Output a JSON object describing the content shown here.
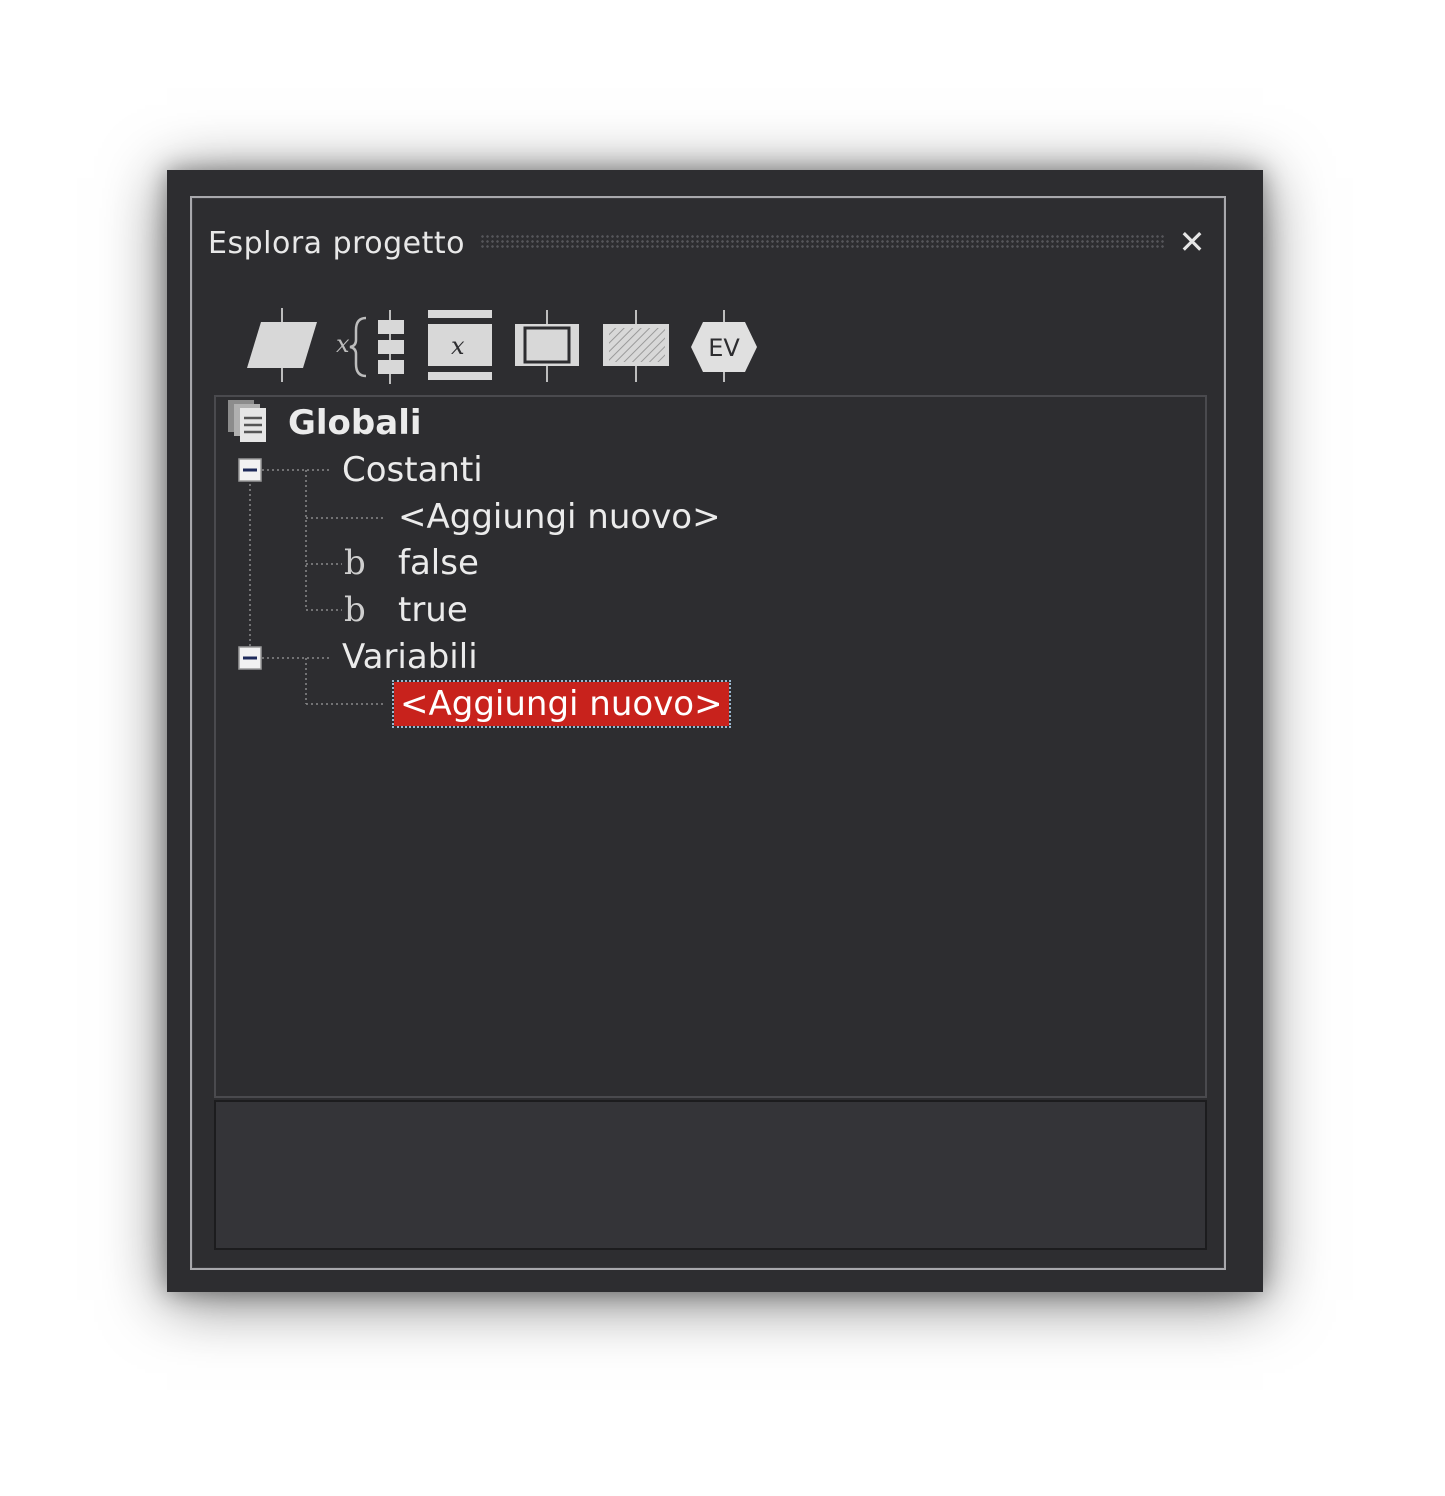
{
  "panel": {
    "title": "Esplora progetto",
    "close_glyph": "✕"
  },
  "toolbar": {
    "items": [
      {
        "name": "input-output-block-icon"
      },
      {
        "name": "variable-declaration-icon",
        "glyph": "x"
      },
      {
        "name": "assignment-block-icon",
        "glyph": "x"
      },
      {
        "name": "subroutine-block-icon"
      },
      {
        "name": "hatched-block-icon"
      },
      {
        "name": "ev-block-icon",
        "glyph": "EV"
      }
    ]
  },
  "tree": {
    "root": {
      "label": "Globali",
      "icon": "globals-icon"
    },
    "groups": [
      {
        "label": "Costanti",
        "expanded": true,
        "children": [
          {
            "label": "<Aggiungi nuovo>"
          },
          {
            "label": "false",
            "icon": "boolean-icon",
            "icon_glyph": "b"
          },
          {
            "label": "true",
            "icon": "boolean-icon",
            "icon_glyph": "b"
          }
        ]
      },
      {
        "label": "Variabili",
        "expanded": true,
        "children": [
          {
            "label": "<Aggiungi nuovo>",
            "selected": true
          }
        ]
      }
    ]
  },
  "colors": {
    "panel_bg": "#2d2d30",
    "selection": "#c8221c",
    "text": "#ebebeb"
  }
}
